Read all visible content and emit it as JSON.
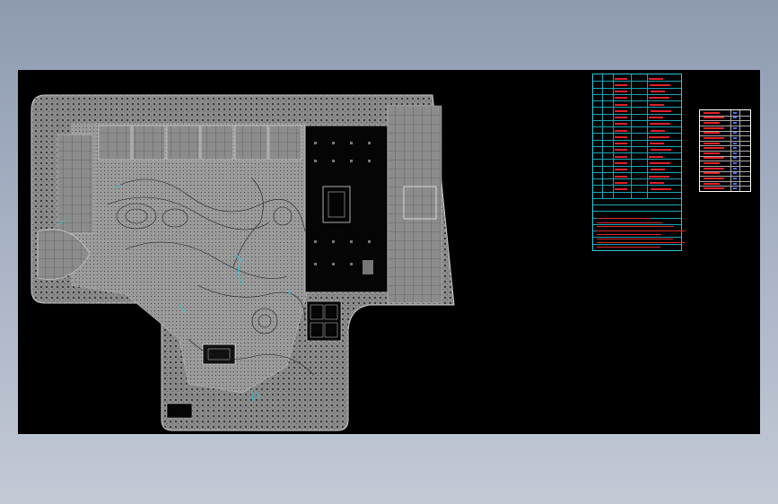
{
  "window": {
    "background": "#9aa5b8"
  },
  "canvas": {
    "background": "#000000"
  },
  "colors": {
    "site_fill": "#8a8a8a",
    "site_dots": "#2b2b2b",
    "building_fill": "#000000",
    "outline": "#cfcfcf",
    "cyan": "#2ec8d8",
    "red": "#e0202a",
    "blue": "#4a6cff"
  },
  "layers": {
    "site_plan": {
      "name": "site-plan-drawing"
    },
    "plant_schedule": {
      "name": "plant-schedule-table",
      "rows": 27,
      "cols": 5
    },
    "legend_table": {
      "name": "legend-table",
      "rows": 16,
      "cols": 4
    }
  }
}
